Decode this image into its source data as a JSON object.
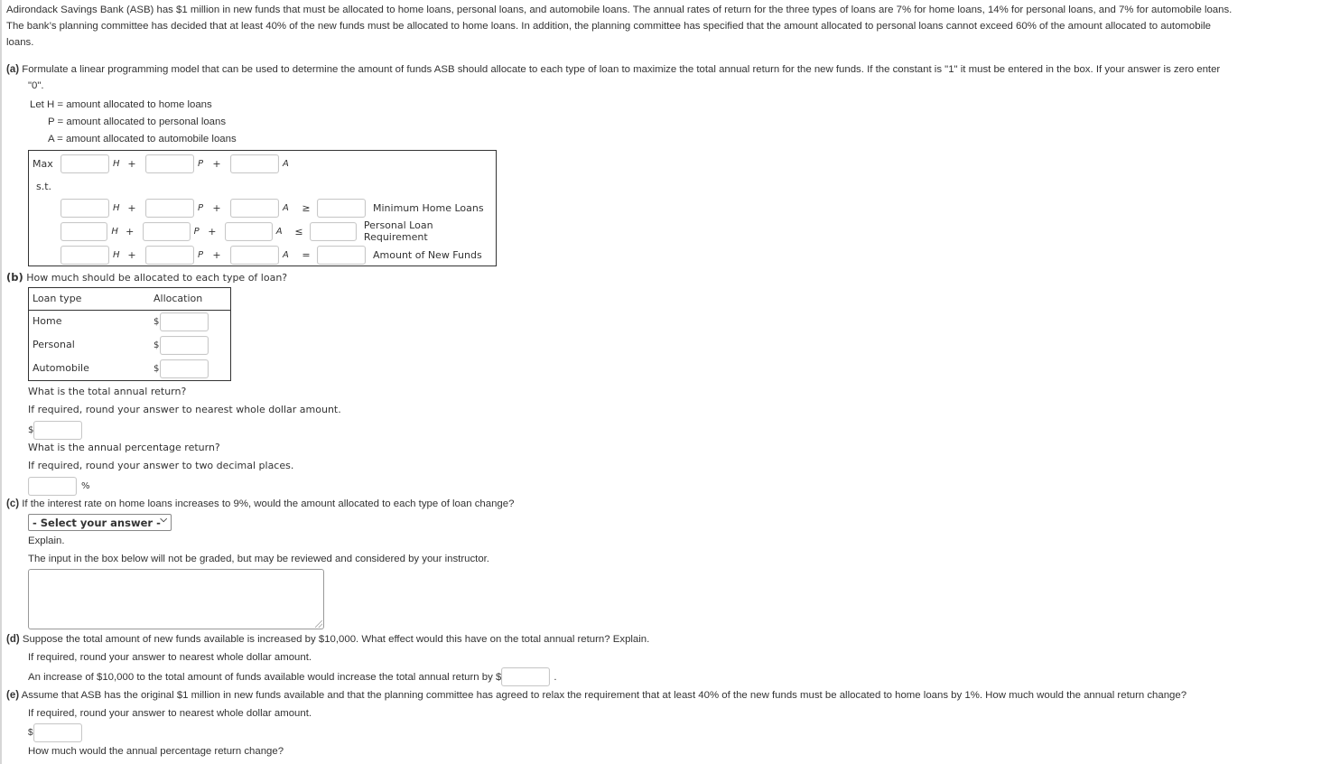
{
  "intro": {
    "line1": "Adirondack Savings Bank (ASB) has $1 million in new funds that must be allocated to home loans, personal loans, and automobile loans. The annual rates of return for the three types of loans are 7% for home loans, 14% for personal loans, and 7% for automobile loans.",
    "line2": "The bank’s planning committee has decided that at least 40% of the new funds must be allocated to home loans. In addition, the planning committee has specified that the amount allocated to personal loans cannot exceed 60% of the amount allocated to automobile",
    "line3": "loans."
  },
  "part_a": {
    "label": "(a)",
    "text1": "Formulate a linear programming model that can be used to determine the amount of funds ASB should allocate to each type of loan to maximize the total annual return for the new funds. If the constant is \"1\" it must be entered in the box. If your answer is zero enter",
    "text2": "\"0\".",
    "def_h": "Let H = amount allocated to home loans",
    "def_p": "P = amount allocated to personal loans",
    "def_a": "A = amount allocated to automobile loans",
    "max_label": "Max",
    "st_label": "s.t.",
    "var_h": "H",
    "var_p": "P",
    "var_a": "A",
    "plus": "+",
    "constraints": [
      {
        "relation": "≥",
        "name": "Minimum Home Loans"
      },
      {
        "relation": "≤",
        "name": "Personal Loan Requirement"
      },
      {
        "relation": "=",
        "name": "Amount of New Funds"
      }
    ]
  },
  "part_b": {
    "label": "(b)",
    "question": "How much should be allocated to each type of loan?",
    "table": {
      "headers": [
        "Loan type",
        "Allocation"
      ],
      "rows": [
        {
          "type": "Home",
          "currency": "$",
          "value": ""
        },
        {
          "type": "Personal",
          "currency": "$",
          "value": ""
        },
        {
          "type": "Automobile",
          "currency": "$",
          "value": ""
        }
      ]
    },
    "q_total": "What is the total annual return?",
    "round_dollar": "If required, round your answer to nearest whole dollar amount.",
    "currency": "$",
    "q_percent": "What is the annual percentage return?",
    "round_two": "If required, round your answer to two decimal places.",
    "percent_sign": "%"
  },
  "part_c": {
    "label": "(c)",
    "question": "If the interest rate on home loans increases to 9%, would the amount allocated to each type of loan change?",
    "select_value": "- Select your answer -",
    "explain": "Explain.",
    "note": "The input in the box below will not be graded, but may be reviewed and considered by your instructor.",
    "explanation_value": ""
  },
  "part_d": {
    "label": "(d)",
    "question": "Suppose the total amount of new funds available is increased by $10,000. What effect would this have on the total annual return? Explain.",
    "round_dollar": "If required, round your answer to nearest whole dollar amount.",
    "sentence": "An increase of $10,000 to the total amount of funds available would increase the total annual return by $",
    "period": "."
  },
  "part_e": {
    "label": "(e)",
    "question": "Assume that ASB has the original $1 million in new funds available and that the planning committee has agreed to relax the requirement that at least 40% of the new funds must be allocated to home loans by 1%. How much would the annual return change?",
    "round_dollar": "If required, round your answer to nearest whole dollar amount.",
    "currency": "$",
    "q_percent": "How much would the annual percentage return change?"
  }
}
